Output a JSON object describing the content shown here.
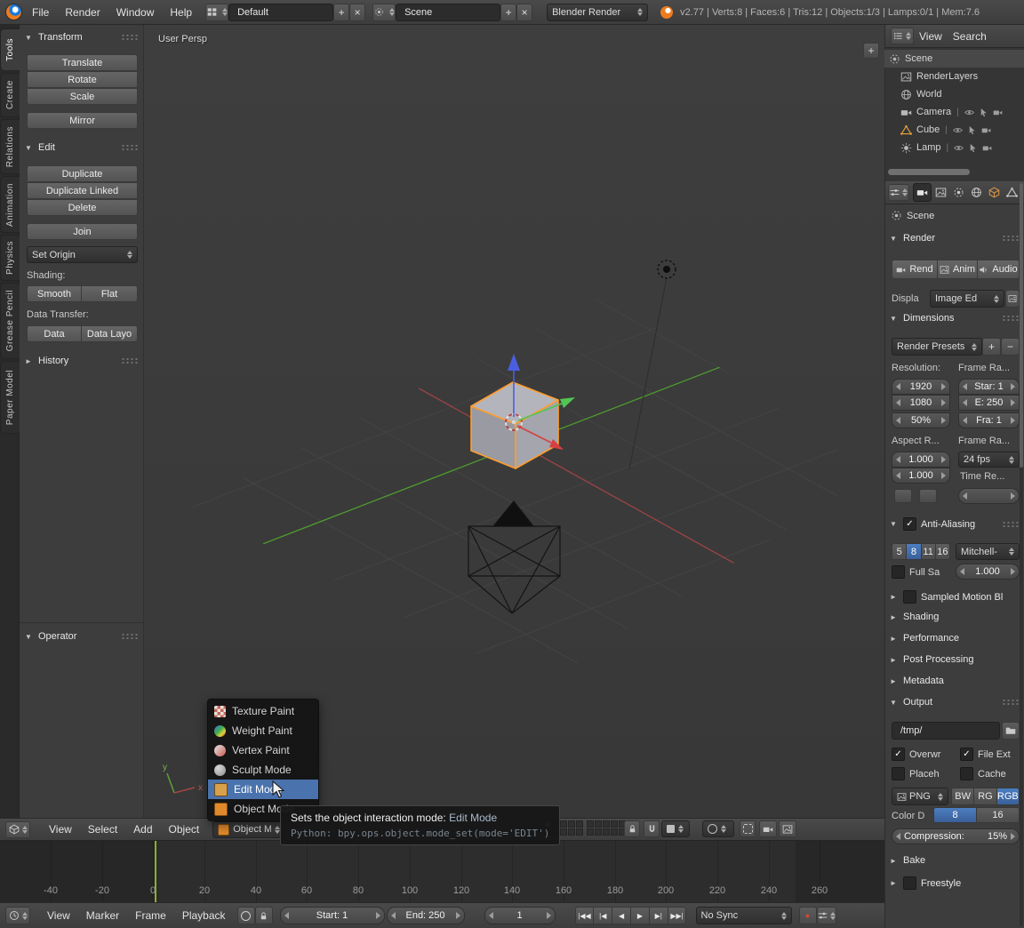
{
  "icons": {
    "plus": "+",
    "close": "×",
    "check": "✓",
    "caret_down": "▼",
    "caret_right": "►",
    "minus": "−",
    "record": "●"
  },
  "topbar": {
    "menus": [
      "File",
      "Render",
      "Window",
      "Help"
    ],
    "layout_name": "Default",
    "scene_name": "Scene",
    "engine": "Blender Render",
    "stats": "v2.77 | Verts:8 | Faces:6 | Tris:12 | Objects:1/3 | Lamps:0/1 | Mem:7.6"
  },
  "tool_shelf": {
    "tabs": [
      "Tools",
      "Create",
      "Relations",
      "Animation",
      "Physics",
      "Grease Pencil",
      "Paper Model"
    ],
    "transform": {
      "title": "Transform",
      "translate": "Translate",
      "rotate": "Rotate",
      "scale": "Scale",
      "mirror": "Mirror"
    },
    "edit": {
      "title": "Edit",
      "duplicate": "Duplicate",
      "duplicate_linked": "Duplicate Linked",
      "del": "Delete",
      "join": "Join",
      "set_origin": "Set Origin",
      "shading_label": "Shading:",
      "smooth": "Smooth",
      "flat": "Flat",
      "data_transfer_label": "Data Transfer:",
      "data": "Data",
      "data_layout": "Data Layo"
    },
    "history_title": "History",
    "operator_title": "Operator"
  },
  "viewport": {
    "view_label": "User Persp",
    "axis_x": "x",
    "axis_y": "y",
    "mode_menu": [
      "Texture Paint",
      "Weight Paint",
      "Vertex Paint",
      "Sculpt Mode",
      "Edit Mode",
      "Object Mode"
    ],
    "header": {
      "menus": [
        "View",
        "Select",
        "Add",
        "Object"
      ],
      "mode": "Object Mo"
    },
    "tooltip": {
      "text": "Sets the object interaction mode:",
      "value": "Edit Mode",
      "python": "Python: bpy.ops.object.mode_set(mode='EDIT')"
    }
  },
  "timeline": {
    "ticks": [
      "-40",
      "-20",
      "0",
      "20",
      "40",
      "60",
      "80",
      "100",
      "120",
      "140",
      "160",
      "180",
      "200",
      "220",
      "240",
      "260"
    ],
    "menus": [
      "View",
      "Marker",
      "Frame",
      "Playback"
    ],
    "start": "Start: 1",
    "end": "End: 250",
    "frame": "1",
    "media": [
      "|◀◀",
      "|◀",
      "◀",
      "▶",
      "▶|",
      "▶▶|"
    ],
    "sync": "No Sync"
  },
  "outliner": {
    "menus": [
      "View",
      "Search"
    ],
    "items": [
      "Scene",
      "RenderLayers",
      "World",
      "Camera",
      "Cube",
      "Lamp"
    ]
  },
  "properties": {
    "breadcrumb": "Scene",
    "render": {
      "title": "Render",
      "render_btn": "Rend",
      "anim_btn": "Anim",
      "audio_btn": "Audio",
      "display_label": "Displa",
      "display_value": "Image Ed"
    },
    "dimensions": {
      "title": "Dimensions",
      "presets": "Render Presets",
      "resolution_label": "Resolution:",
      "frame_range_label": "Frame Ra...",
      "res_x": "1920",
      "res_y": "1080",
      "res_pct": "50%",
      "frame_start": "Star: 1",
      "frame_end": "E: 250",
      "frame_step": "Fra: 1",
      "aspect_label": "Aspect R...",
      "frame_rate_label": "Frame Ra...",
      "aspect_x": "1.000",
      "aspect_y": "1.000",
      "fps": "24 fps",
      "time_remap_label": "Time Re..."
    },
    "aa": {
      "title": "Anti-Aliasing",
      "samples": [
        "5",
        "8",
        "11",
        "16"
      ],
      "filter": "Mitchell-",
      "full_sample": "Full Sa",
      "filter_size": "1.000"
    },
    "collapsed": {
      "motion_blur": "Sampled Motion Bl",
      "shading": "Shading",
      "performance": "Performance",
      "post": "Post Processing",
      "metadata": "Metadata",
      "bake": "Bake",
      "freestyle": "Freestyle"
    },
    "output": {
      "title": "Output",
      "path": "/tmp/",
      "overwrite": "Overwr",
      "file_ext": "File Ext",
      "placeholders": "Placeh",
      "cache": "Cache",
      "format": "PNG",
      "color": [
        "BW",
        "RG",
        "RGB"
      ],
      "depth_label": "Color D",
      "depths": [
        "8",
        "16"
      ],
      "compression_label": "Compression:",
      "compression_value": "15%"
    }
  }
}
